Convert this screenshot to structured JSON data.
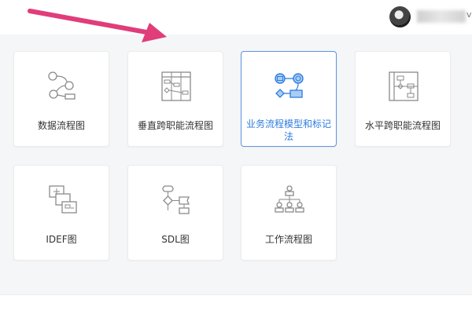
{
  "header": {
    "username_suffix": "v"
  },
  "accent_color": "#2f7be0",
  "arrow_color": "#e03d7a",
  "templates": [
    {
      "label": "数据流程图",
      "icon": "data-flow-icon"
    },
    {
      "label": "垂直跨职能流程图",
      "icon": "vertical-swimlane-icon"
    },
    {
      "label": "业务流程模型和标记法",
      "icon": "bpmn-icon",
      "selected": true
    },
    {
      "label": "水平跨职能流程图",
      "icon": "horizontal-swimlane-icon"
    },
    {
      "label": "IDEF图",
      "icon": "idef-icon"
    },
    {
      "label": "SDL图",
      "icon": "sdl-icon"
    },
    {
      "label": "工作流程图",
      "icon": "workflow-icon"
    }
  ]
}
